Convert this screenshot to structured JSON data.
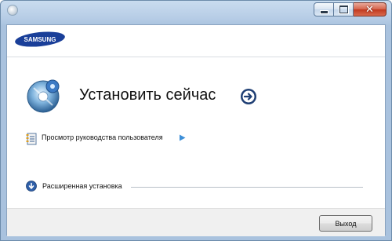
{
  "window": {
    "controls": {
      "minimize": "minimize",
      "maximize": "maximize",
      "close": "close"
    }
  },
  "header": {
    "brand": "SAMSUNG"
  },
  "main": {
    "install_now": "Установить сейчас",
    "view_manual": "Просмотр руководства пользователя",
    "advanced_install": "Расширенная установка"
  },
  "footer": {
    "exit_button": "Выход"
  },
  "icons": {
    "install": "disc-install-icon",
    "install_go": "arrow-right-circle-icon",
    "manual": "manual-book-icon",
    "manual_go": "triangle-right-icon",
    "advanced": "arrow-down-circle-icon"
  },
  "colors": {
    "brand_blue": "#1a3f99",
    "accent_blue": "#2f5fa8",
    "close_red": "#c0391f"
  }
}
